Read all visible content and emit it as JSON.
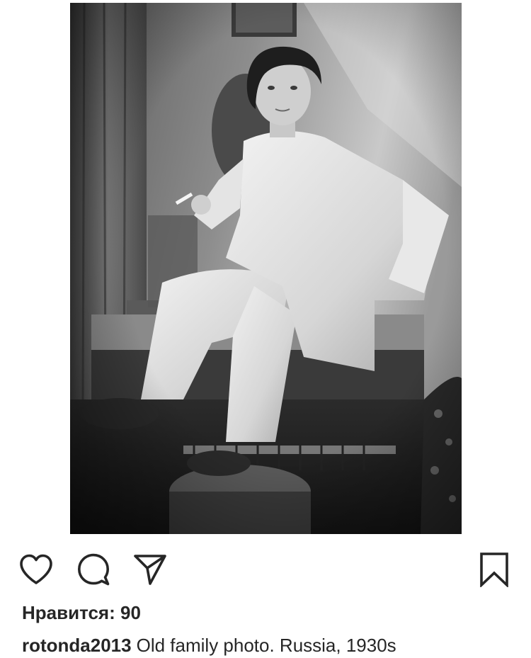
{
  "post": {
    "image": {
      "subject": "",
      "style": "black-and-white"
    },
    "actions": {
      "like_icon": "heart-icon",
      "comment_icon": "comment-icon",
      "share_icon": "paper-plane-icon",
      "save_icon": "bookmark-icon"
    },
    "likes": {
      "label": "Нравится:",
      "count": "90"
    },
    "caption": {
      "username": "rotonda2013",
      "text": "Old family photo. Russia, 1930s"
    }
  },
  "colors": {
    "text": "#262626",
    "background": "#ffffff"
  }
}
